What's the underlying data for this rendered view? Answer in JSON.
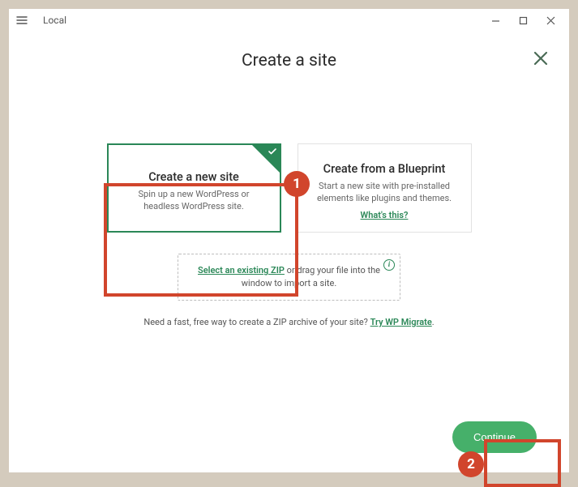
{
  "titlebar": {
    "title": "Local"
  },
  "page": {
    "title": "Create a site"
  },
  "cards": {
    "new_site": {
      "title": "Create a new site",
      "desc": "Spin up a new WordPress or headless WordPress site."
    },
    "blueprint": {
      "title": "Create from a Blueprint",
      "desc": "Start a new site with pre-installed elements like plugins and themes.",
      "link": "What's this?"
    }
  },
  "dropzone": {
    "link": "Select an existing ZIP",
    "rest": " or drag your file into the window to import a site."
  },
  "hint": {
    "text": "Need a fast, free way to create a ZIP archive of your site? ",
    "link": "Try WP Migrate",
    "tail": "."
  },
  "footer": {
    "continue": "Continue"
  },
  "annotations": {
    "one": "1",
    "two": "2"
  }
}
